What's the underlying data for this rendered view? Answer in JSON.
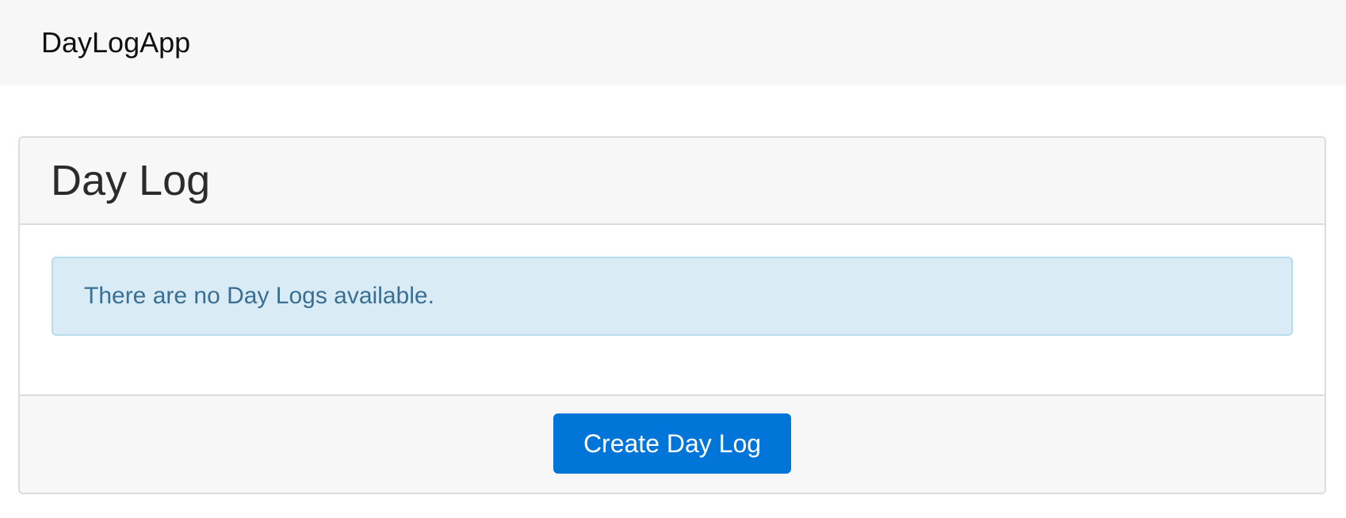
{
  "navbar": {
    "brand": "DayLogApp"
  },
  "card": {
    "title": "Day Log",
    "empty_message": "There are no Day Logs available.",
    "create_button_label": "Create Day Log"
  },
  "colors": {
    "primary": "#0275d8",
    "alert_info_bg": "#d9ecf5",
    "alert_info_text": "#3a6f93",
    "navbar_bg": "#f7f7f7"
  }
}
